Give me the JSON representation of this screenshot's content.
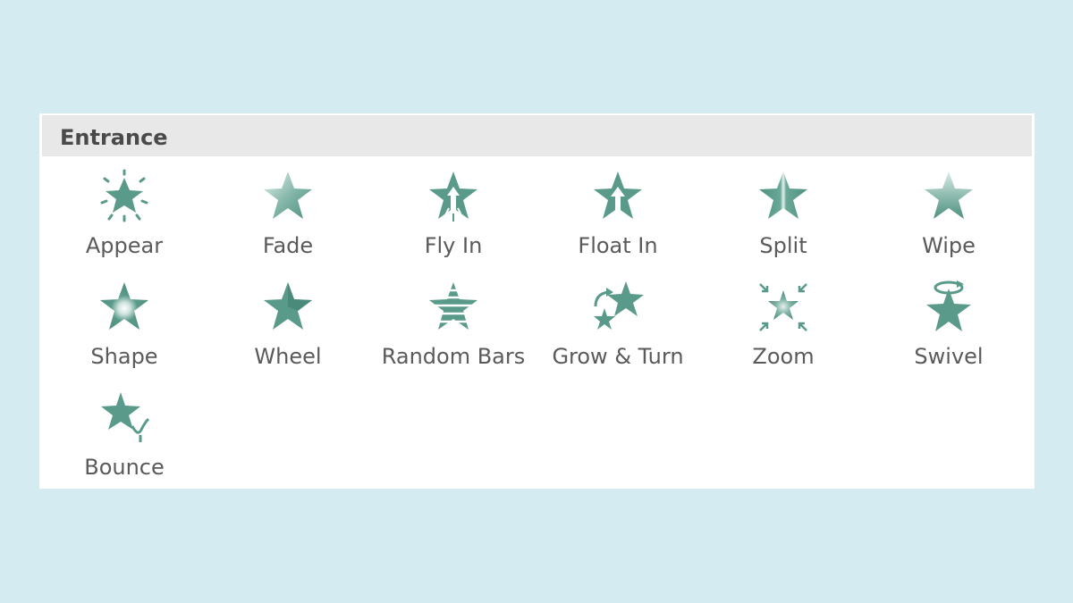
{
  "section": {
    "title": "Entrance"
  },
  "effects": [
    {
      "label": "Appear",
      "icon": "appear-star-icon"
    },
    {
      "label": "Fade",
      "icon": "fade-star-icon"
    },
    {
      "label": "Fly In",
      "icon": "fly-in-star-icon"
    },
    {
      "label": "Float In",
      "icon": "float-in-star-icon"
    },
    {
      "label": "Split",
      "icon": "split-star-icon"
    },
    {
      "label": "Wipe",
      "icon": "wipe-star-icon"
    },
    {
      "label": "Shape",
      "icon": "shape-star-icon"
    },
    {
      "label": "Wheel",
      "icon": "wheel-star-icon"
    },
    {
      "label": "Random Bars",
      "icon": "random-bars-star-icon"
    },
    {
      "label": "Grow & Turn",
      "icon": "grow-turn-star-icon"
    },
    {
      "label": "Zoom",
      "icon": "zoom-star-icon"
    },
    {
      "label": "Swivel",
      "icon": "swivel-star-icon"
    },
    {
      "label": "Bounce",
      "icon": "bounce-star-icon"
    }
  ],
  "colors": {
    "accent": "#5a9a8a",
    "accent_dark": "#3f7f6f",
    "background": "#d4ebf1"
  }
}
